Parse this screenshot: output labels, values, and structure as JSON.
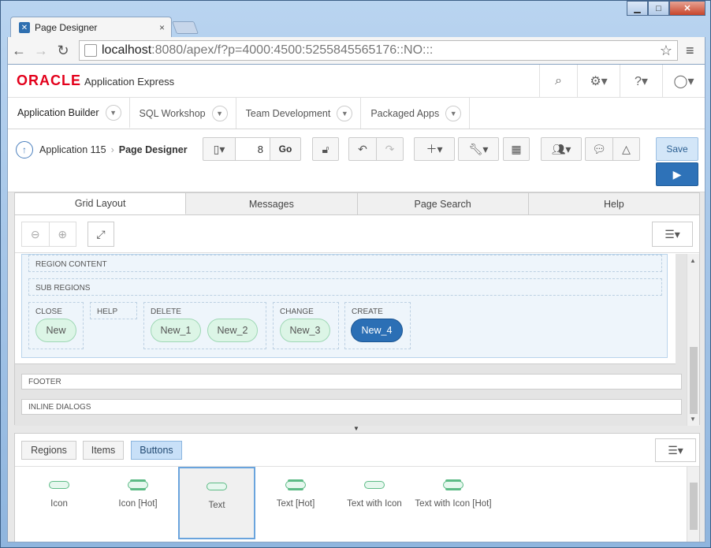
{
  "browser": {
    "tab_title": "Page Designer",
    "tab_close": "×",
    "url_host": "localhost",
    "url_rest": ":8080/apex/f?p=4000:4500:5255845565176::NO:::"
  },
  "apex": {
    "logo_oracle": "ORACLE",
    "logo_product": "Application Express",
    "nav_tabs": [
      {
        "label": "Application Builder"
      },
      {
        "label": "SQL Workshop"
      },
      {
        "label": "Team Development"
      },
      {
        "label": "Packaged Apps"
      }
    ],
    "breadcrumb": {
      "parent": "Application 115",
      "current": "Page Designer"
    },
    "page_number": "8",
    "go_label": "Go",
    "save_label": "Save"
  },
  "panel": {
    "tabs": [
      "Grid Layout",
      "Messages",
      "Page Search",
      "Help"
    ]
  },
  "grid": {
    "region_content": "REGION CONTENT",
    "sub_regions": "SUB REGIONS",
    "slots": {
      "close": "CLOSE",
      "help": "HELP",
      "delete": "DELETE",
      "change": "CHANGE",
      "create": "CREATE"
    },
    "buttons": {
      "new": "New",
      "new1": "New_1",
      "new2": "New_2",
      "new3": "New_3",
      "new4": "New_4"
    },
    "footer": "FOOTER",
    "inline_dialogs": "INLINE DIALOGS"
  },
  "gallery": {
    "tabs": [
      "Regions",
      "Items",
      "Buttons"
    ],
    "active_tab": "Buttons",
    "items": [
      {
        "label": "Icon"
      },
      {
        "label": "Icon [Hot]"
      },
      {
        "label": "Text"
      },
      {
        "label": "Text [Hot]"
      },
      {
        "label": "Text with Icon"
      },
      {
        "label": "Text with Icon [Hot]"
      }
    ]
  },
  "colors": {
    "oracle_red": "#e3001b",
    "accent_blue": "#2b6fb5",
    "button_green": "#dcf5e6"
  }
}
